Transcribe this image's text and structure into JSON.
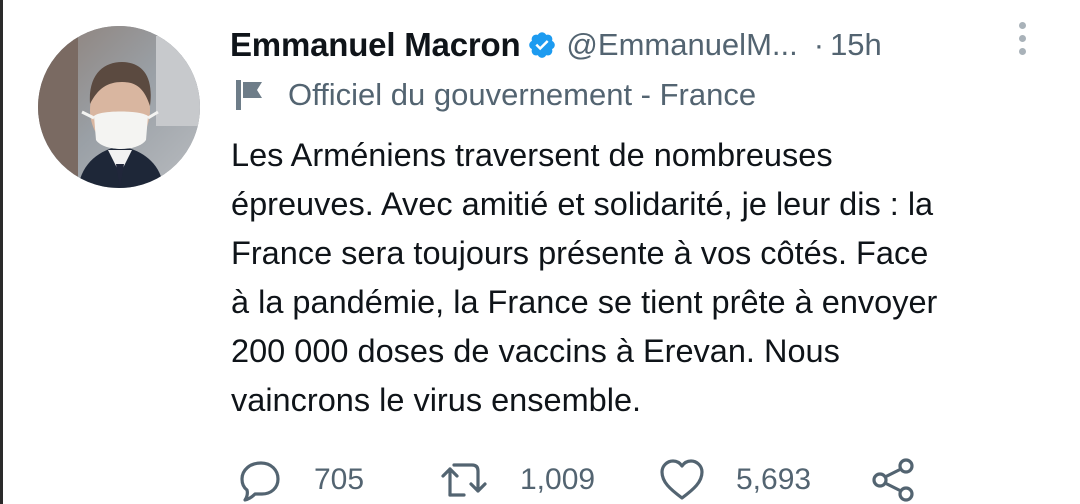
{
  "tweet": {
    "author_name": "Emmanuel Macron",
    "handle": "@EmmanuelM...",
    "separator": "·",
    "time": "15h",
    "label": "Officiel du gouvernement - France",
    "text_lines": [
      "Les Arméniens traversent de nombreuses",
      "épreuves. Avec amitié et solidarité, je leur dis : la",
      "France sera toujours présente à vos côtés. Face",
      "à la pandémie, la France se tient prête à envoyer",
      "200 000 doses de vaccins à Erevan. Nous",
      "vaincrons le virus ensemble."
    ]
  },
  "actions": {
    "replies": "705",
    "retweets": "1,009",
    "likes": "5,693"
  },
  "icons": {
    "verified": "verified-badge-icon",
    "more": "more-vertical-icon",
    "label": "flag-icon",
    "reply": "reply-icon",
    "retweet": "retweet-icon",
    "like": "heart-icon",
    "share": "share-icon"
  },
  "colors": {
    "text": "#0f1419",
    "secondary": "#536471",
    "verified": "#1d9bf0"
  }
}
